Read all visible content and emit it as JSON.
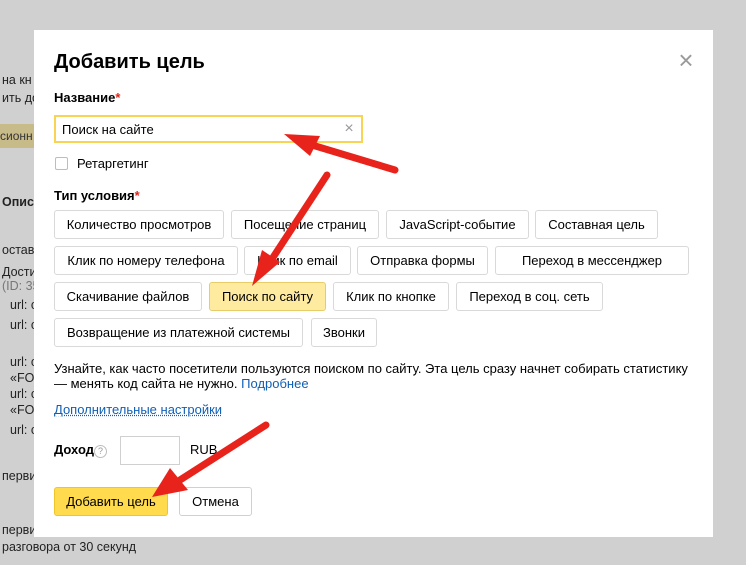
{
  "background": {
    "lines": [
      "на кн",
      "ить до",
      "сионн",
      "Описа",
      "остав",
      "Дости",
      "(ID: 35",
      "url: с",
      "url: с",
      "url: с",
      "«FO",
      "url: с",
      "«FO",
      "url: с",
      "первич",
      "первич",
      "разговора от 30 секунд"
    ]
  },
  "modal": {
    "title": "Добавить цель",
    "close_icon": "close-icon",
    "name_label": "Название",
    "required_mark": "*",
    "name_value": "Поиск на сайте",
    "retargeting_label": "Ретаргетинг",
    "condition_label": "Тип условия",
    "chips": [
      "Количество просмотров",
      "Посещение страниц",
      "JavaScript-событие",
      "Составная цель",
      "Клик по номеру телефона",
      "Клик по email",
      "Отправка формы",
      "Переход в мессенджер",
      "Скачивание файлов",
      "Поиск по сайту",
      "Клик по кнопке",
      "Переход в соц. сеть",
      "Возвращение из платежной системы",
      "Звонки"
    ],
    "active_chip": "Поиск по сайту",
    "description": "Узнайте, как часто посетители пользуются поиском по сайту. Эта цель сразу начнет собирать статистику — менять код сайта не нужно.",
    "more_link": "Подробнее",
    "advanced_link": "Дополнительные настройки",
    "revenue_label": "Доход",
    "help_icon": "?",
    "currency": "RUB",
    "add_button": "Добавить цель",
    "cancel_button": "Отмена"
  },
  "colors": {
    "accent_yellow": "#ffdb4d",
    "active_chip": "#ffeba0",
    "link": "#0f5fb5",
    "required": "#e0251b",
    "annotation_arrow": "#e8231b"
  }
}
